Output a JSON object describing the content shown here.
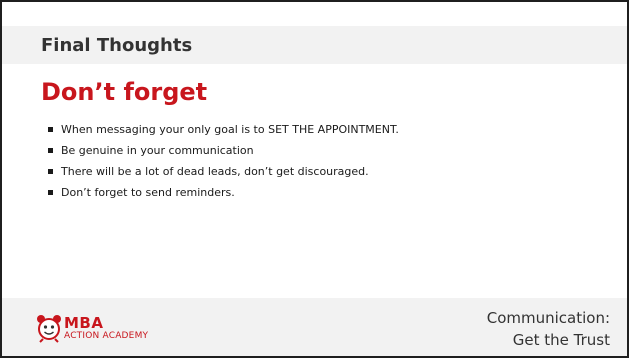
{
  "slide": {
    "section_title": "Final Thoughts",
    "heading": "Don’t forget",
    "bullets": [
      "When messaging your only goal is to SET THE APPOINTMENT.",
      "Be genuine in your communication",
      "There will be a lot of dead leads, don’t get discouraged.",
      "Don’t forget to send reminders."
    ],
    "footer": {
      "logo_main": "MBA",
      "logo_sub": "ACTION ACADEMY",
      "topic_line1": "Communication:",
      "topic_line2": "Get the Trust"
    }
  },
  "colors": {
    "accent_red": "#c8161d",
    "band_gray": "#f2f2f2",
    "text_dark": "#333333"
  },
  "icons": {
    "logo": "alarm-clock-mascot-icon"
  }
}
